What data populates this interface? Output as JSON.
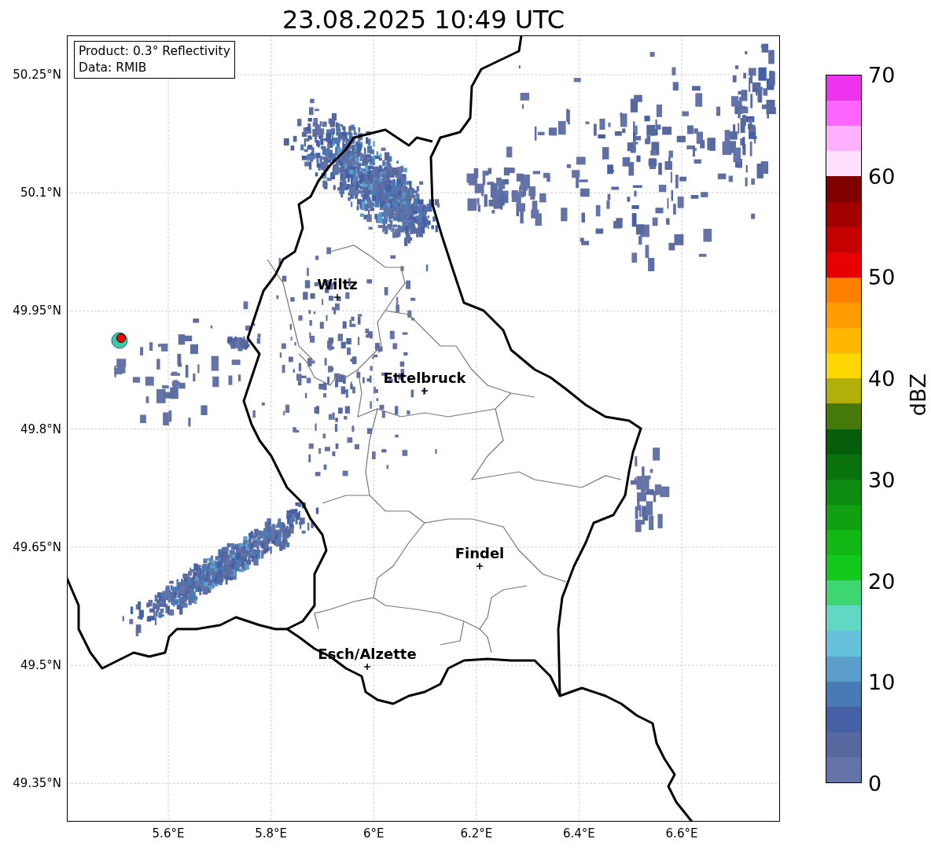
{
  "title": "23.08.2025 10:49 UTC",
  "info_box": {
    "lines": [
      "Product: 0.3° Reflectivity",
      "Data: RMIB"
    ]
  },
  "map": {
    "lat_labels": [
      "50.25°N",
      "50.1°N",
      "49.95°N",
      "49.8°N",
      "49.65°N",
      "49.5°N",
      "49.35°N"
    ],
    "lon_labels": [
      "5.6°E",
      "5.8°E",
      "6°E",
      "6.2°E",
      "6.4°E",
      "6.6°E"
    ],
    "cities": [
      {
        "name": "Wiltz"
      },
      {
        "name": "Ettelbruck"
      },
      {
        "name": "Findel"
      },
      {
        "name": "Esch/Alzette"
      }
    ]
  },
  "colorbar": {
    "label": "dBZ",
    "ticks": [
      "70",
      "60",
      "50",
      "40",
      "30",
      "20",
      "10",
      "0"
    ],
    "bands": [
      {
        "color": "#ee33ee"
      },
      {
        "color": "#ff66ff"
      },
      {
        "color": "#ffb0ff"
      },
      {
        "color": "#ffe0ff"
      },
      {
        "color": "#800000"
      },
      {
        "color": "#a30000"
      },
      {
        "color": "#c40000"
      },
      {
        "color": "#e60000"
      },
      {
        "color": "#ff7f00"
      },
      {
        "color": "#ff9c00"
      },
      {
        "color": "#ffb700"
      },
      {
        "color": "#ffd700"
      },
      {
        "color": "#b0b008"
      },
      {
        "color": "#457a0a"
      },
      {
        "color": "#075e0a"
      },
      {
        "color": "#0a720c"
      },
      {
        "color": "#0d8a10"
      },
      {
        "color": "#10a012"
      },
      {
        "color": "#12b816"
      },
      {
        "color": "#12c81a"
      },
      {
        "color": "#3ed670"
      },
      {
        "color": "#60d8c4"
      },
      {
        "color": "#66c2dc"
      },
      {
        "color": "#5a9ec9"
      },
      {
        "color": "#4a7ab5"
      },
      {
        "color": "#4660a6"
      },
      {
        "color": "#56699f"
      },
      {
        "color": "#6574a8"
      }
    ]
  }
}
